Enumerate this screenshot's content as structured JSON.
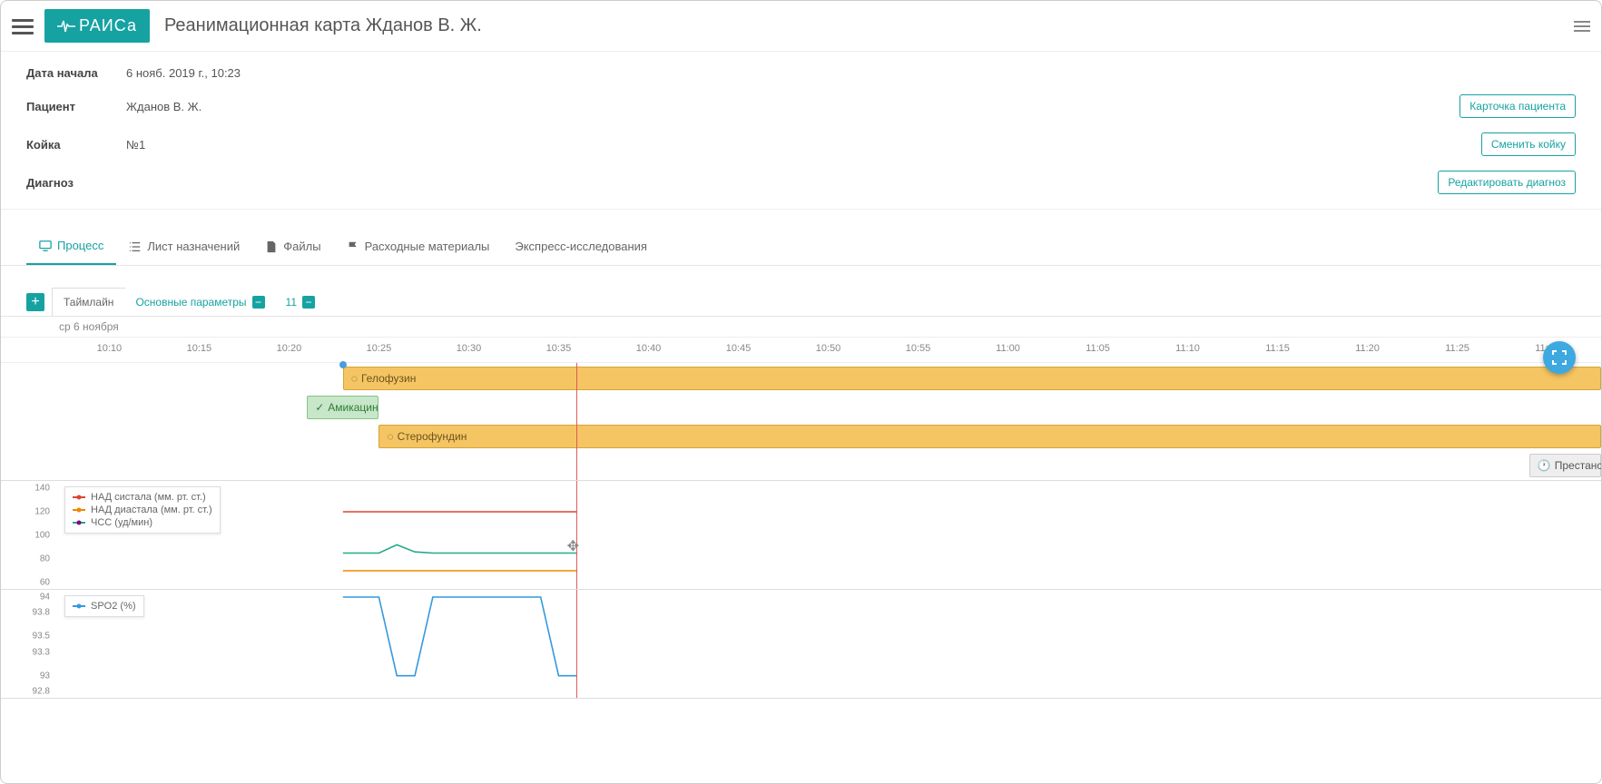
{
  "header": {
    "logo_text": "РАИСа",
    "page_title": "Реанимационная карта Жданов В. Ж."
  },
  "info": {
    "rows": [
      {
        "label": "Дата начала",
        "value": "6 нояб. 2019 г., 10:23",
        "button": null
      },
      {
        "label": "Пациент",
        "value": "Жданов В. Ж.",
        "button": "Карточка пациента"
      },
      {
        "label": "Койка",
        "value": "№1",
        "button": "Сменить койку"
      },
      {
        "label": "Диагноз",
        "value": "",
        "button": "Редактировать диагноз"
      }
    ]
  },
  "tabs": [
    {
      "label": "Процесс",
      "icon": "monitor"
    },
    {
      "label": "Лист назначений",
      "icon": "list"
    },
    {
      "label": "Файлы",
      "icon": "file"
    },
    {
      "label": "Расходные материалы",
      "icon": "flag"
    },
    {
      "label": "Экспресс-исследования",
      "icon": null
    }
  ],
  "subtabs": {
    "tab1": "Таймлайн",
    "tab2": "Основные параметры",
    "tab3_count": "11"
  },
  "timeline": {
    "date_label": "ср 6 ноября",
    "time_start_min": 607,
    "time_end_min": 693,
    "now_min": 636,
    "start_marker_min": 623,
    "ticks": [
      "10:10",
      "10:15",
      "10:20",
      "10:25",
      "10:30",
      "10:35",
      "10:40",
      "10:45",
      "10:50",
      "10:55",
      "11:00",
      "11:05",
      "11:10",
      "11:15",
      "11:20",
      "11:25",
      "11:30"
    ],
    "bars": [
      {
        "label": "Гелофузин",
        "type": "yellow",
        "row": 0,
        "start_min": 623,
        "end_min": 693,
        "icon": "spin"
      },
      {
        "label": "Амикацин",
        "type": "green",
        "row": 1,
        "start_min": 621,
        "end_min": 625,
        "icon": "check"
      },
      {
        "label": "Стерофундин",
        "type": "yellow",
        "row": 2,
        "start_min": 625,
        "end_min": 693,
        "icon": "spin"
      },
      {
        "label": "Престанс",
        "type": "grey",
        "row": 3,
        "start_min": 689,
        "end_min": 693,
        "icon": "clock"
      }
    ]
  },
  "chart_data": [
    {
      "type": "line",
      "title": "",
      "xlabel": "",
      "ylabel": "",
      "ylim": [
        60,
        140
      ],
      "yticks": [
        60,
        80,
        100,
        120,
        140
      ],
      "x_range_min": [
        607,
        693
      ],
      "series": [
        {
          "name": "НАД систала (мм. рт. ст.)",
          "color": "#d43",
          "x": [
            623,
            636
          ],
          "y": [
            120,
            120
          ]
        },
        {
          "name": "НАД диастала (мм. рт. ст.)",
          "color": "#e80",
          "x": [
            623,
            636
          ],
          "y": [
            70,
            70
          ]
        },
        {
          "name": "ЧСС (уд/мин)",
          "color": "#2a8",
          "x": [
            623,
            625,
            626,
            627,
            628,
            636
          ],
          "y": [
            85,
            85,
            92,
            86,
            85,
            85
          ]
        }
      ],
      "legend": [
        "НАД систала (мм. рт. ст.)",
        "НАД диастала (мм. рт. ст.)",
        "ЧСС (уд/мин)"
      ]
    },
    {
      "type": "line",
      "title": "",
      "xlabel": "",
      "ylabel": "",
      "ylim": [
        92.8,
        94
      ],
      "yticks": [
        92.8,
        93,
        93.3,
        93.5,
        93.8,
        94
      ],
      "x_range_min": [
        607,
        693
      ],
      "series": [
        {
          "name": "SPO2 (%)",
          "color": "#39d",
          "x": [
            623,
            625,
            626,
            627,
            628,
            634,
            635,
            636
          ],
          "y": [
            94,
            94,
            93,
            93,
            94,
            94,
            93,
            93
          ]
        }
      ],
      "legend": [
        "SPO2 (%)"
      ]
    }
  ]
}
